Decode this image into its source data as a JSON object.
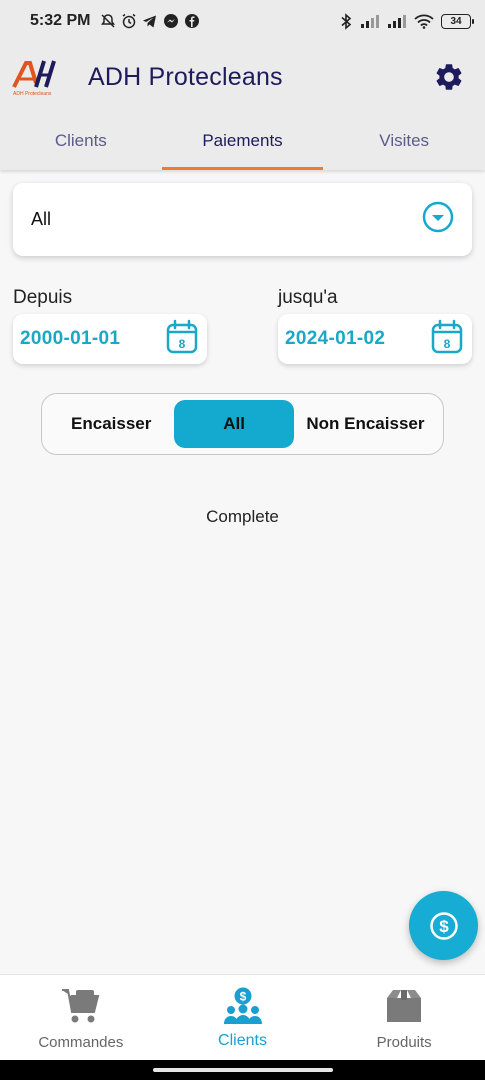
{
  "status_bar": {
    "time": "5:32 PM",
    "battery": "34"
  },
  "app_bar": {
    "title": "ADH Protecleans",
    "logo_text": "ADH Protecleans"
  },
  "tabs": [
    {
      "label": "Clients",
      "active": false
    },
    {
      "label": "Paiements",
      "active": true
    },
    {
      "label": "Visites",
      "active": false
    }
  ],
  "filter": {
    "selected": "All"
  },
  "dates": {
    "from_label": "Depuis",
    "from_value": "2000-01-01",
    "to_label": "jusqu'a",
    "to_value": "2024-01-02",
    "calendar_day": "8"
  },
  "segment": {
    "options": [
      "Encaisser",
      "All",
      "Non Encaisser"
    ],
    "selected": "All"
  },
  "list_status": "Complete",
  "bottom_nav": [
    {
      "label": "Commandes",
      "icon": "cart-icon",
      "active": false
    },
    {
      "label": "Clients",
      "icon": "clients-icon",
      "active": true
    },
    {
      "label": "Produits",
      "icon": "box-icon",
      "active": false
    }
  ],
  "colors": {
    "accent": "#14aacf",
    "title": "#1e1b5c",
    "tab_indicator": "#f07c2a"
  }
}
